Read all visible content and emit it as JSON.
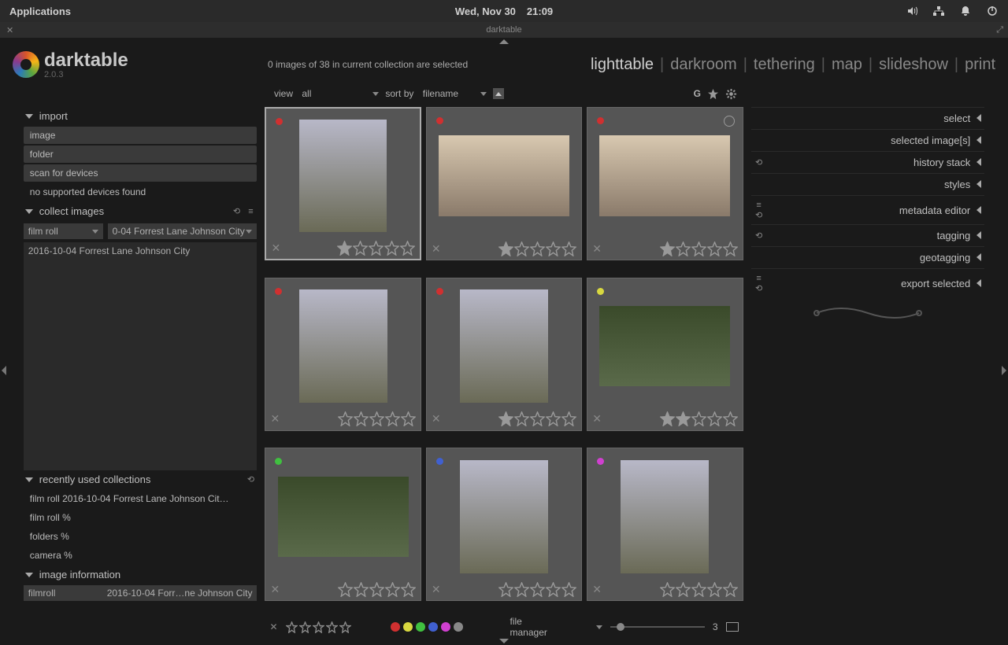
{
  "sysbar": {
    "applications": "Applications",
    "date": "Wed, Nov 30",
    "time": "21:09"
  },
  "titlebar": {
    "title": "darktable"
  },
  "app": {
    "name": "darktable",
    "version": "2.0.3"
  },
  "status": "0 images of 38 in current collection are selected",
  "nav": {
    "lighttable": "lighttable",
    "darkroom": "darkroom",
    "tethering": "tethering",
    "map": "map",
    "slideshow": "slideshow",
    "print": "print"
  },
  "toolbar": {
    "view_label": "view",
    "view_value": "all",
    "sort_label": "sort by",
    "sort_value": "filename",
    "group_sym": "G"
  },
  "left": {
    "import": {
      "title": "import",
      "items": [
        "image",
        "folder",
        "scan for devices",
        "no supported devices found"
      ]
    },
    "collect": {
      "title": "collect images",
      "by": "film roll",
      "val": "0-04 Forrest Lane Johnson City",
      "list0": "2016-10-04 Forrest Lane Johnson City"
    },
    "recent": {
      "title": "recently used collections",
      "items": [
        "film roll 2016-10-04 Forrest Lane Johnson Cit…",
        "film roll %",
        "folders %",
        "camera %"
      ]
    },
    "info": {
      "title": "image information",
      "k0": "filmroll",
      "v0": "2016-10-04 Forr…ne Johnson City"
    }
  },
  "right": {
    "select": "select",
    "selected_images": "selected image[s]",
    "history": "history stack",
    "styles": "styles",
    "metadata": "metadata editor",
    "tagging": "tagging",
    "geo": "geotagging",
    "export": "export selected"
  },
  "thumbs": [
    {
      "dot": "red",
      "rating": 1,
      "shape": "portrait",
      "sel": true
    },
    {
      "dot": "red",
      "rating": 1,
      "shape": "landscape"
    },
    {
      "dot": "red",
      "rating": 1,
      "shape": "landscape",
      "altered": true
    },
    {
      "dot": "red",
      "rating": 0,
      "shape": "portrait"
    },
    {
      "dot": "red",
      "rating": 1,
      "shape": "portrait"
    },
    {
      "dot": "yellow",
      "rating": 2,
      "shape": "hedge"
    },
    {
      "dot": "green",
      "rating": 0,
      "shape": "hedge"
    },
    {
      "dot": "blue",
      "rating": 0,
      "shape": "portrait"
    },
    {
      "dot": "magenta",
      "rating": 0,
      "shape": "portrait"
    }
  ],
  "bottom": {
    "filemanager": "file manager",
    "zoom": "3",
    "label_colors": [
      "#d03030",
      "#d8d840",
      "#40c040",
      "#4060d0",
      "#d040d0",
      "#888"
    ]
  }
}
